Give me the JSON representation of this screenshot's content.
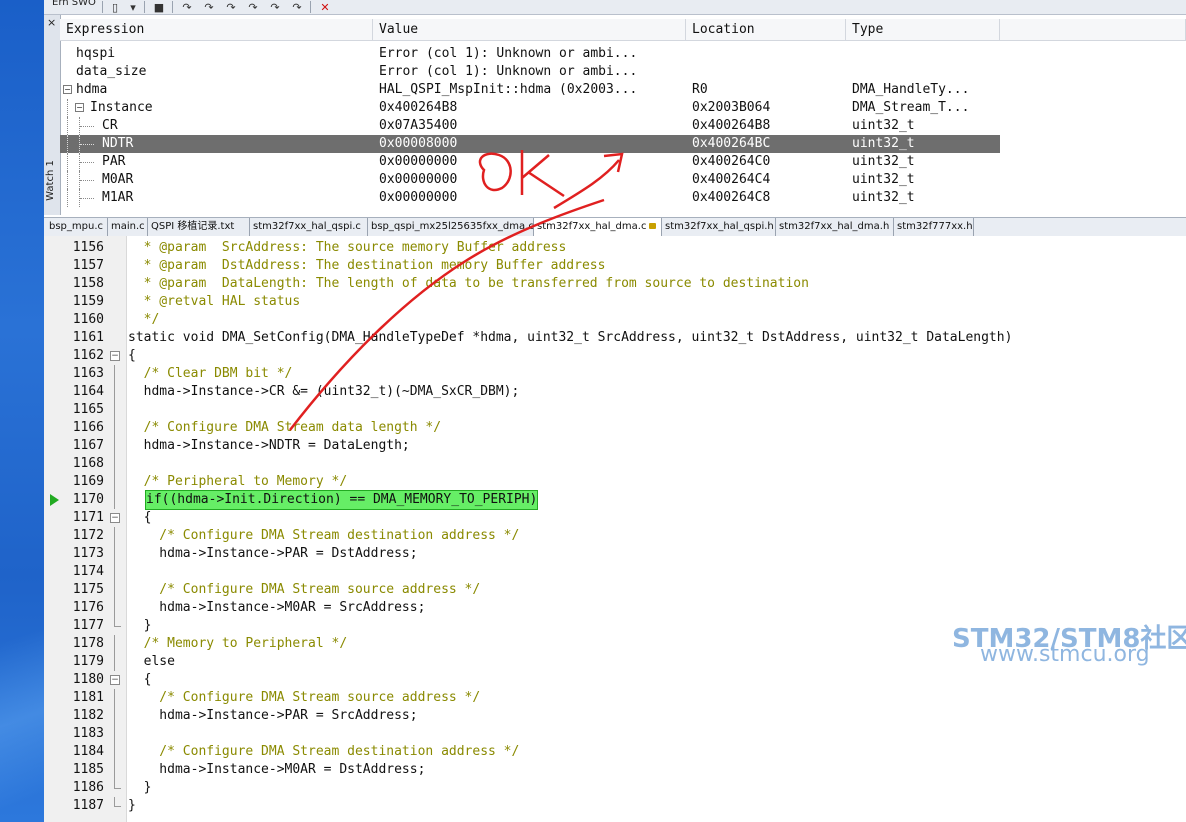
{
  "toolbar": {
    "left_label": "Ern SWO"
  },
  "watch": {
    "panel_label": "Watch 1",
    "columns": [
      "Expression",
      "Value",
      "Location",
      "Type"
    ],
    "rows": [
      {
        "expr": "hqspi",
        "value": "Error (col 1): Unknown or ambi...",
        "location": "",
        "type": ""
      },
      {
        "expr": "data_size",
        "value": "Error (col 1): Unknown or ambi...",
        "location": "",
        "type": ""
      },
      {
        "expr": "hdma",
        "value": "HAL_QSPI_MspInit::hdma (0x2003...",
        "location": "R0",
        "type": "DMA_HandleTy..."
      },
      {
        "expr": "Instance",
        "value": "0x400264B8",
        "location": "0x2003B064",
        "type": "DMA_Stream_T..."
      },
      {
        "expr": "CR",
        "value": "0x07A35400",
        "location": "0x400264B8",
        "type": "uint32_t"
      },
      {
        "expr": "NDTR",
        "value": "0x00008000",
        "location": "0x400264BC",
        "type": "uint32_t"
      },
      {
        "expr": "PAR",
        "value": "0x00000000",
        "location": "0x400264C0",
        "type": "uint32_t"
      },
      {
        "expr": "M0AR",
        "value": "0x00000000",
        "location": "0x400264C4",
        "type": "uint32_t"
      },
      {
        "expr": "M1AR",
        "value": "0x00000000",
        "location": "0x400264C8",
        "type": "uint32_t"
      }
    ],
    "selected_row": 5
  },
  "tabs": [
    "bsp_mpu.c",
    "main.c",
    "QSPI 移植记录.txt",
    "stm32f7xx_hal_qspi.c",
    "bsp_qspi_mx25l25635fxx_dma.c",
    "stm32f7xx_hal_dma.c",
    "stm32f7xx_hal_qspi.h",
    "stm32f7xx_hal_dma.h",
    "stm32f777xx.h"
  ],
  "active_tab": 5,
  "editor": {
    "lines": [
      {
        "n": "1156",
        "code": "  * @param  SrcAddress: The source memory Buffer address",
        "type": "comment"
      },
      {
        "n": "1157",
        "code": "  * @param  DstAddress: The destination memory Buffer address",
        "type": "comment"
      },
      {
        "n": "1158",
        "code": "  * @param  DataLength: The length of data to be transferred from source to destination",
        "type": "comment"
      },
      {
        "n": "1159",
        "code": "  * @retval HAL status",
        "type": "comment"
      },
      {
        "n": "1160",
        "code": "  */",
        "type": "comment"
      },
      {
        "n": "1161",
        "code": "static void DMA_SetConfig(DMA_HandleTypeDef *hdma, uint32_t SrcAddress, uint32_t DstAddress, uint32_t DataLength)",
        "type": "code"
      },
      {
        "n": "1162",
        "code": "{",
        "type": "code"
      },
      {
        "n": "1163",
        "code": "  /* Clear DBM bit */",
        "type": "comment"
      },
      {
        "n": "1164",
        "code": "  hdma->Instance->CR &= (uint32_t)(~DMA_SxCR_DBM);",
        "type": "code"
      },
      {
        "n": "1165",
        "code": "",
        "type": "code"
      },
      {
        "n": "1166",
        "code": "  /* Configure DMA Stream data length */",
        "type": "comment"
      },
      {
        "n": "1167",
        "code": "  hdma->Instance->NDTR = DataLength;",
        "type": "code"
      },
      {
        "n": "1168",
        "code": "",
        "type": "code"
      },
      {
        "n": "1169",
        "code": "  /* Peripheral to Memory */",
        "type": "comment"
      },
      {
        "n": "1170",
        "code": "if((hdma->Init.Direction) == DMA_MEMORY_TO_PERIPH)",
        "type": "current"
      },
      {
        "n": "1171",
        "code": "  {",
        "type": "code"
      },
      {
        "n": "1172",
        "code": "    /* Configure DMA Stream destination address */",
        "type": "comment"
      },
      {
        "n": "1173",
        "code": "    hdma->Instance->PAR = DstAddress;",
        "type": "code"
      },
      {
        "n": "1174",
        "code": "",
        "type": "code"
      },
      {
        "n": "1175",
        "code": "    /* Configure DMA Stream source address */",
        "type": "comment"
      },
      {
        "n": "1176",
        "code": "    hdma->Instance->M0AR = SrcAddress;",
        "type": "code"
      },
      {
        "n": "1177",
        "code": "  }",
        "type": "code"
      },
      {
        "n": "1178",
        "code": "  /* Memory to Peripheral */",
        "type": "comment"
      },
      {
        "n": "1179",
        "code": "  else",
        "type": "code"
      },
      {
        "n": "1180",
        "code": "  {",
        "type": "code"
      },
      {
        "n": "1181",
        "code": "    /* Configure DMA Stream source address */",
        "type": "comment"
      },
      {
        "n": "1182",
        "code": "    hdma->Instance->PAR = SrcAddress;",
        "type": "code"
      },
      {
        "n": "1183",
        "code": "",
        "type": "code"
      },
      {
        "n": "1184",
        "code": "    /* Configure DMA Stream destination address */",
        "type": "comment"
      },
      {
        "n": "1185",
        "code": "    hdma->Instance->M0AR = DstAddress;",
        "type": "code"
      },
      {
        "n": "1186",
        "code": "  }",
        "type": "code"
      },
      {
        "n": "1187",
        "code": "}",
        "type": "code"
      }
    ]
  },
  "watermark": {
    "line1": "STM32/STM8社区",
    "line2": "www.stmcu.org"
  },
  "annotation": {
    "text": "ok",
    "color": "#e02020"
  },
  "colors": {
    "comment": "#8a8a00",
    "highlight": "#66ee66",
    "selection": "#6e6e6e",
    "accent": "#1f63c9"
  },
  "icons": [
    "breakpoint-arrow-icon",
    "lock-icon",
    "close-icon",
    "delete-x-icon"
  ]
}
